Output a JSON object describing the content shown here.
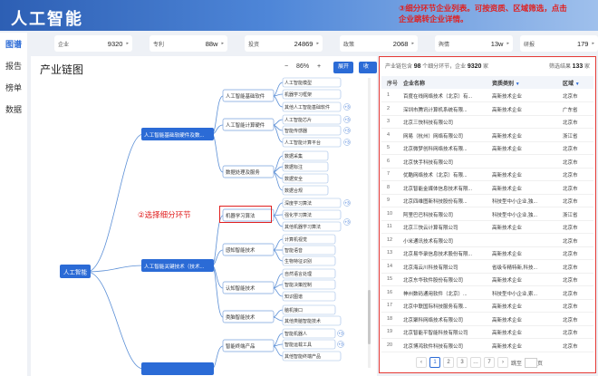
{
  "app": {
    "title": "人工智能"
  },
  "sidebar": {
    "items": [
      {
        "label": "图谱",
        "active": true
      },
      {
        "label": "报告",
        "active": false
      },
      {
        "label": "榜单",
        "active": false
      },
      {
        "label": "数据",
        "active": false
      }
    ]
  },
  "stats": [
    {
      "label": "企业",
      "value": "9320"
    },
    {
      "label": "专利",
      "value": "88w"
    },
    {
      "label": "投资",
      "value": "24869"
    },
    {
      "label": "政策",
      "value": "2068"
    },
    {
      "label": "舆情",
      "value": "13w"
    },
    {
      "label": "研报",
      "value": "179"
    }
  ],
  "chain": {
    "title": "产业链图",
    "zoom_minus": "−",
    "zoom_value": "86%",
    "zoom_plus": "+",
    "expand_label": "展开",
    "collapse_label": "收起",
    "root": "人工智能",
    "level1": [
      "人工智能基础软硬件及数...",
      "人工智能关键技术（技术...",
      ""
    ],
    "level2": [
      "人工智能基础软件",
      "人工智能计算硬件",
      "数据处理及服务",
      "机器学习算法",
      "感知智能技术",
      "认知智能技术",
      "类脑智能技术",
      "智能终端产品"
    ],
    "level3": [
      "人工智能模型",
      "机器学习框架",
      "其他人工智能基础软件",
      "人工智能芯片",
      "智能传感器",
      "人工智能计算平台",
      "数据采集",
      "数据标注",
      "数据安全",
      "数据合规",
      "深度学习算法",
      "强化学习算法",
      "其他机器学习算法",
      "计算机视觉",
      "智能语音",
      "生物特征识别",
      "自然语言处理",
      "智能决策控制",
      "知识图谱",
      "脑机接口",
      "其他类脑智能技术",
      "智能机器人",
      "智能运载工具",
      "其他智能终端产品"
    ],
    "badges": [
      "+3",
      "+3",
      "+3",
      "+3",
      "+3",
      "+3",
      "+3",
      "+3"
    ]
  },
  "annotations": {
    "top": "③细分环节企业列表。可按资质、区域筛选，点击企业跳转企业详情。",
    "left": "②选择细分环节"
  },
  "list": {
    "summary_prefix": "产业链包含",
    "summary_count1": "98",
    "summary_mid": "个细分环节，企业",
    "summary_count2": "9320",
    "summary_suffix": "家",
    "filter_label": "筛选结果",
    "filter_count": "133",
    "filter_unit": "家",
    "headers": {
      "no": "序号",
      "name": "企业名称",
      "type": "资质类别",
      "area": "区域"
    },
    "rows": [
      {
        "no": "1",
        "name": "百度在线网络技术（北京）有...",
        "type": "高新技术企业",
        "area": "北京市"
      },
      {
        "no": "2",
        "name": "深圳市腾讯计算机系统有限...",
        "type": "高新技术企业",
        "area": "广东省"
      },
      {
        "no": "3",
        "name": "北京三快科技有限公司",
        "type": "",
        "area": "北京市"
      },
      {
        "no": "4",
        "name": "网易（杭州）网络有限公司",
        "type": "高新技术企业",
        "area": "浙江省"
      },
      {
        "no": "5",
        "name": "北京微梦创科网络技术有限...",
        "type": "高新技术企业",
        "area": "北京市"
      },
      {
        "no": "6",
        "name": "北京快手科技有限公司",
        "type": "",
        "area": "北京市"
      },
      {
        "no": "7",
        "name": "优酷网络技术（北京）有限...",
        "type": "高新技术企业",
        "area": "北京市"
      },
      {
        "no": "8",
        "name": "北京智能金媒体信息技术有限...",
        "type": "高新技术企业",
        "area": "北京市"
      },
      {
        "no": "9",
        "name": "北京四维图新科技股份有限...",
        "type": "科技型中小企业,独...",
        "area": "北京市"
      },
      {
        "no": "10",
        "name": "阿里巴巴科技有限公司",
        "type": "科技型中小企业,独...",
        "area": "浙江省"
      },
      {
        "no": "11",
        "name": "北京三快云计算有限公司",
        "type": "高新技术企业",
        "area": "北京市"
      },
      {
        "no": "12",
        "name": "小米通讯技术有限公司",
        "type": "",
        "area": "北京市"
      },
      {
        "no": "13",
        "name": "北京易华录信息技术股份有限...",
        "type": "高新技术企业",
        "area": "北京市"
      },
      {
        "no": "14",
        "name": "北京海云川科技有限公司",
        "type": "省级专精特新,科技...",
        "area": "北京市"
      },
      {
        "no": "15",
        "name": "北京东华软件股份有限公司",
        "type": "高新技术企业",
        "area": "北京市"
      },
      {
        "no": "16",
        "name": "神州数码通用软件（北京）...",
        "type": "科技型中小企业,索...",
        "area": "北京市"
      },
      {
        "no": "17",
        "name": "北京中联国际科技服务有限...",
        "type": "高新技术企业",
        "area": "北京市"
      },
      {
        "no": "18",
        "name": "北京聚科网络技术有限公司",
        "type": "高新技术企业",
        "area": "北京市"
      },
      {
        "no": "19",
        "name": "北京智能平智能科技有限公司",
        "type": "高新技术企业",
        "area": "北京市"
      },
      {
        "no": "20",
        "name": "北京博鸿软件科技有限公司",
        "type": "高新技术企业",
        "area": "北京市"
      }
    ],
    "pager": {
      "prev": "‹",
      "pages": [
        "1",
        "2",
        "3",
        "…",
        "7"
      ],
      "next": "›",
      "jump_label": "跳至",
      "jump_suffix": "页"
    }
  }
}
